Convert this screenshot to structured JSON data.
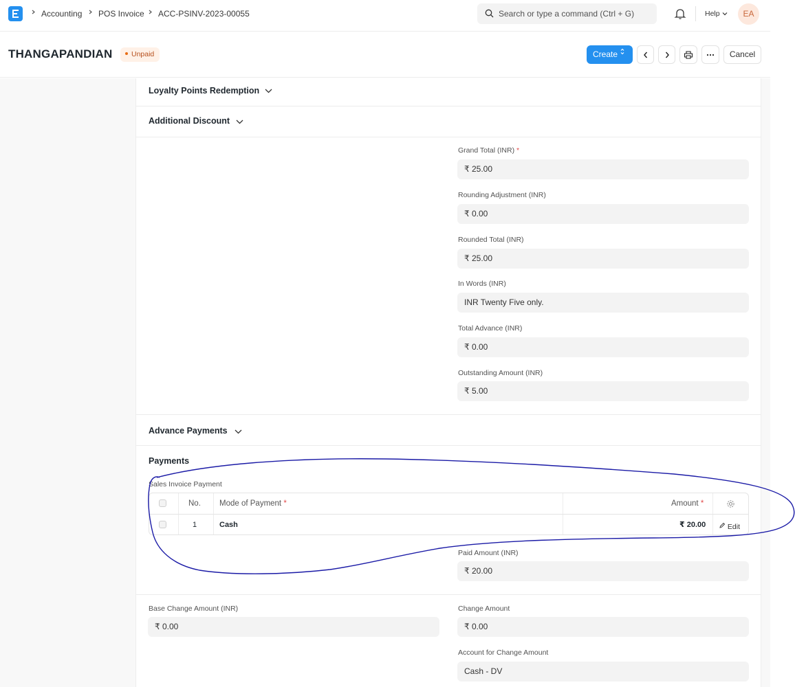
{
  "breadcrumbs": [
    "Accounting",
    "POS Invoice",
    "ACC-PSINV-2023-00055"
  ],
  "search": {
    "placeholder": "Search or type a command (Ctrl + G)"
  },
  "navbar": {
    "help_label": "Help",
    "avatar_initials": "EA"
  },
  "header": {
    "title": "THANGAPANDIAN",
    "status": "Unpaid",
    "create_label": "Create",
    "cancel_label": "Cancel"
  },
  "sections": {
    "loyalty": "Loyalty Points Redemption",
    "additional_discount": "Additional Discount",
    "advance_payments": "Advance Payments",
    "payments": "Payments"
  },
  "totals": [
    {
      "label": "Grand Total (INR)",
      "required": "*",
      "value": "₹ 25.00"
    },
    {
      "label": "Rounding Adjustment (INR)",
      "value": "₹ 0.00"
    },
    {
      "label": "Rounded Total (INR)",
      "value": "₹ 25.00"
    },
    {
      "label": "In Words (INR)",
      "value": "INR Twenty Five only."
    },
    {
      "label": "Total Advance (INR)",
      "value": "₹ 0.00"
    },
    {
      "label": "Outstanding Amount (INR)",
      "value": "₹ 5.00"
    }
  ],
  "payments_table": {
    "label": "Sales Invoice Payment",
    "columns": {
      "no": "No.",
      "mode": "Mode of Payment",
      "amount": "Amount",
      "required": "*"
    },
    "rows": [
      {
        "no": "1",
        "mode": "Cash",
        "amount": "₹ 20.00",
        "edit_label": "Edit"
      }
    ]
  },
  "paid_amount": {
    "label": "Paid Amount (INR)",
    "value": "₹ 20.00"
  },
  "base_change_amount": {
    "label": "Base Change Amount (INR)",
    "value": "₹ 0.00"
  },
  "change_amount": {
    "label": "Change Amount",
    "value": "₹ 0.00"
  },
  "account_for_change": {
    "label": "Account for Change Amount",
    "value": "Cash - DV"
  },
  "colors": {
    "primary": "#2490ef",
    "status_orange": "#e86c13",
    "annotation_ink": "#1a1aa6"
  }
}
